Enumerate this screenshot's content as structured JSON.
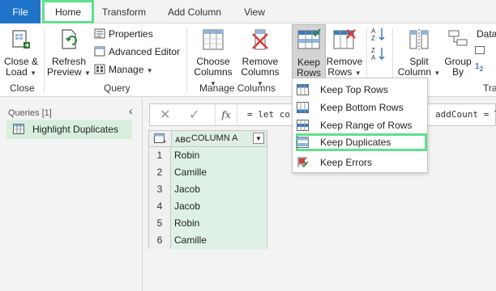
{
  "tabs": {
    "file": "File",
    "home": "Home",
    "transform": "Transform",
    "add_column": "Add Column",
    "view": "View"
  },
  "ribbon": {
    "close_load": {
      "line1": "Close &",
      "line2": "Load"
    },
    "refresh_preview": {
      "line1": "Refresh",
      "line2": "Preview"
    },
    "properties": "Properties",
    "advanced_editor": "Advanced Editor",
    "manage": "Manage",
    "choose_columns": {
      "line1": "Choose",
      "line2": "Columns"
    },
    "remove_columns": {
      "line1": "Remove",
      "line2": "Columns"
    },
    "keep_rows": {
      "line1": "Keep",
      "line2": "Rows"
    },
    "remove_rows": {
      "line1": "Remove",
      "line2": "Rows"
    },
    "split_column": {
      "line1": "Split",
      "line2": "Column"
    },
    "group_by": {
      "line1": "Group",
      "line2": "By"
    },
    "data_type_partial": "Data",
    "trans_partial": "Tra",
    "groups": {
      "close": "Close",
      "query": "Query",
      "manage_columns": "Manage Columns"
    }
  },
  "queries_panel": {
    "header": "Queries [1]",
    "items": [
      {
        "label": "Highlight Duplicates"
      }
    ]
  },
  "formula_bar": {
    "fx": "fx",
    "text_left": "= let co",
    "text_right": "addCount = T"
  },
  "grid": {
    "column_header": "COLUMN A",
    "type_badge": "ABC",
    "rows": [
      {
        "num": "1",
        "value": "Robin"
      },
      {
        "num": "2",
        "value": "Camille"
      },
      {
        "num": "3",
        "value": "Jacob"
      },
      {
        "num": "4",
        "value": "Jacob"
      },
      {
        "num": "5",
        "value": "Robin"
      },
      {
        "num": "6",
        "value": "Camille"
      }
    ]
  },
  "keep_rows_menu": {
    "items": [
      {
        "label": "Keep Top Rows",
        "icon": "keep-top-rows-icon"
      },
      {
        "label": "Keep Bottom Rows",
        "icon": "keep-bottom-rows-icon"
      },
      {
        "label": "Keep Range of Rows",
        "icon": "keep-range-icon"
      },
      {
        "label": "Keep Duplicates",
        "icon": "keep-duplicates-icon"
      },
      {
        "label": "Keep Errors",
        "icon": "keep-errors-icon"
      }
    ]
  },
  "colors": {
    "file_tab": "#1f74c9",
    "highlight": "#5fe08a",
    "grid_cell": "#dff1e6",
    "query_selected": "#d8efe0"
  }
}
